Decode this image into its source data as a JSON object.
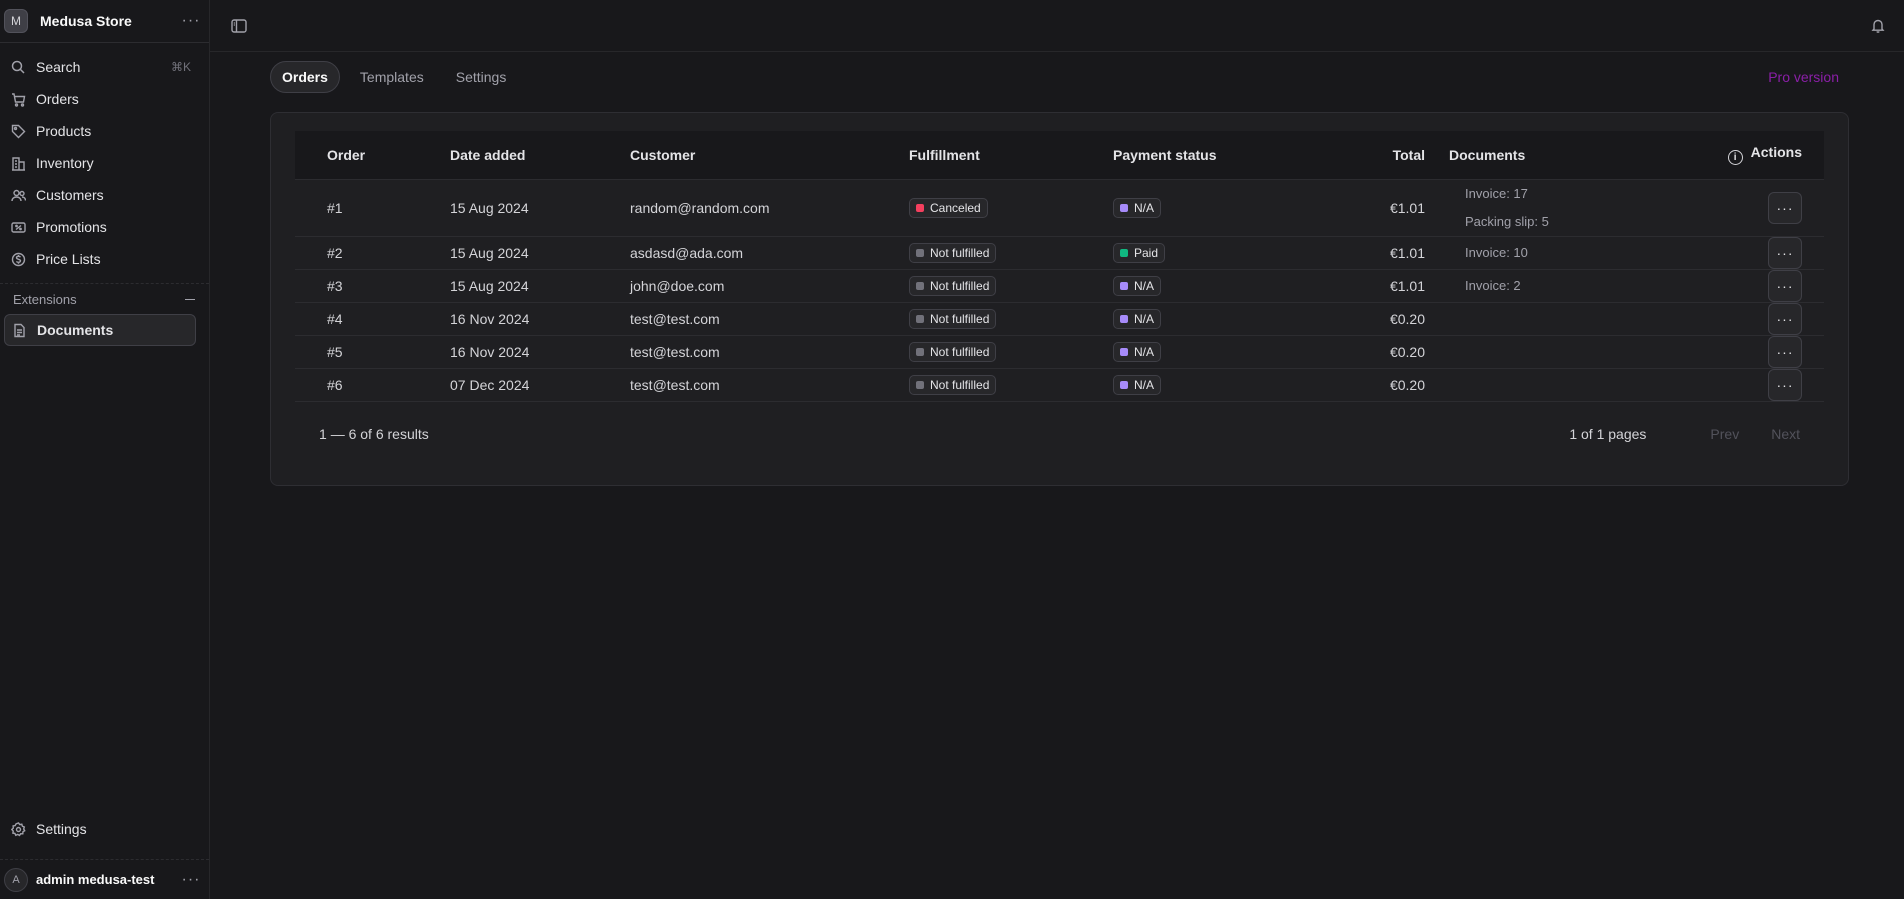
{
  "store": {
    "initial": "M",
    "name": "Medusa Store"
  },
  "nav": {
    "search": {
      "label": "Search",
      "shortcut": "⌘K"
    },
    "items": [
      {
        "label": "Orders",
        "icon": "cart-icon"
      },
      {
        "label": "Products",
        "icon": "tag-icon"
      },
      {
        "label": "Inventory",
        "icon": "building-icon"
      },
      {
        "label": "Customers",
        "icon": "users-icon"
      },
      {
        "label": "Promotions",
        "icon": "receipt-percent-icon"
      },
      {
        "label": "Price Lists",
        "icon": "currency-icon"
      }
    ],
    "extensions_label": "Extensions",
    "documents_label": "Documents",
    "settings_label": "Settings"
  },
  "user": {
    "initial": "A",
    "name": "admin medusa-test"
  },
  "tabs": [
    "Orders",
    "Templates",
    "Settings"
  ],
  "pro_link": "Pro version",
  "table": {
    "headers": {
      "order": "Order",
      "date": "Date added",
      "customer": "Customer",
      "fulfillment": "Fulfillment",
      "payment": "Payment status",
      "total": "Total",
      "documents": "Documents",
      "actions": "Actions"
    },
    "rows": [
      {
        "order": "#1",
        "date": "15 Aug 2024",
        "customer": "random@random.com",
        "fulfillment": "Canceled",
        "payment": "N/A",
        "total": "€1.01",
        "docs": [
          "Invoice: 17",
          "Packing slip: 5"
        ]
      },
      {
        "order": "#2",
        "date": "15 Aug 2024",
        "customer": "asdasd@ada.com",
        "fulfillment": "Not fulfilled",
        "payment": "Paid",
        "total": "€1.01",
        "docs": [
          "Invoice: 10"
        ]
      },
      {
        "order": "#3",
        "date": "15 Aug 2024",
        "customer": "john@doe.com",
        "fulfillment": "Not fulfilled",
        "payment": "N/A",
        "total": "€1.01",
        "docs": [
          "Invoice: 2"
        ]
      },
      {
        "order": "#4",
        "date": "16 Nov 2024",
        "customer": "test@test.com",
        "fulfillment": "Not fulfilled",
        "payment": "N/A",
        "total": "€0.20",
        "docs": []
      },
      {
        "order": "#5",
        "date": "16 Nov 2024",
        "customer": "test@test.com",
        "fulfillment": "Not fulfilled",
        "payment": "N/A",
        "total": "€0.20",
        "docs": []
      },
      {
        "order": "#6",
        "date": "07 Dec 2024",
        "customer": "test@test.com",
        "fulfillment": "Not fulfilled",
        "payment": "N/A",
        "total": "€0.20",
        "docs": []
      }
    ]
  },
  "pagination": {
    "range_start": "1",
    "dash": "—",
    "summary": "6 of 6 results",
    "pages": "1 of 1 pages",
    "prev": "Prev",
    "next": "Next"
  },
  "colors": {
    "canceled": "#f43f5e",
    "not_fulfilled": "#71717a",
    "na": "#a78bfa",
    "paid": "#10b981",
    "pro": "#8b1fa8"
  }
}
